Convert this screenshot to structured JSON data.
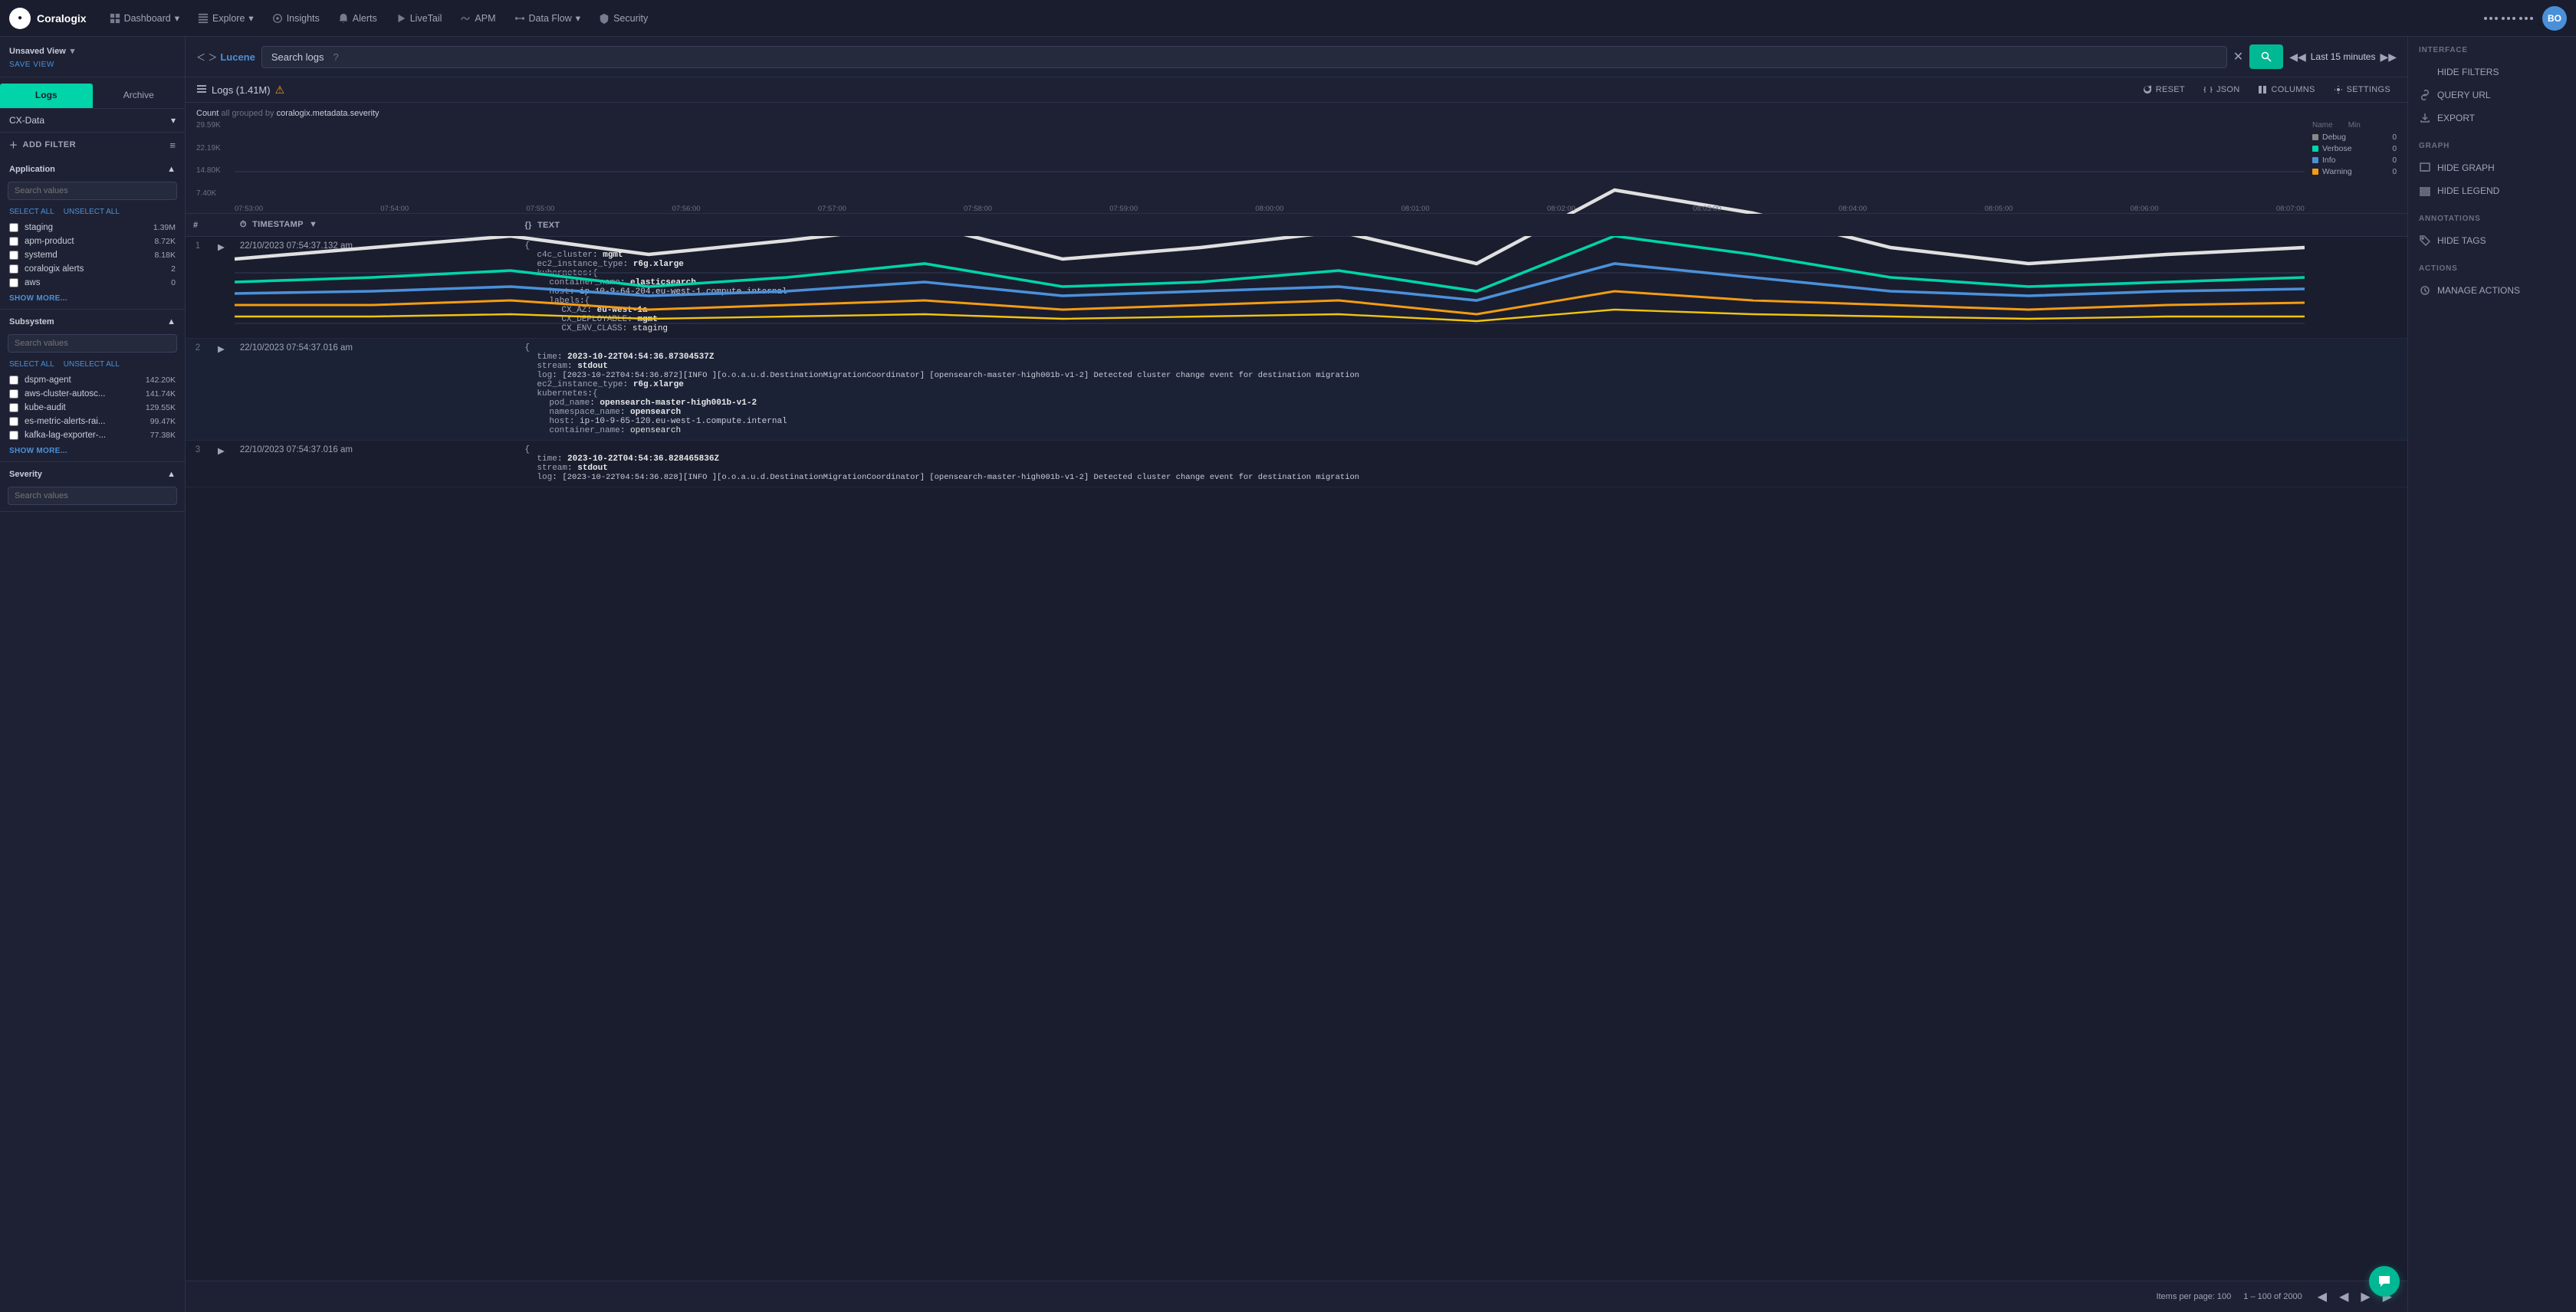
{
  "app": {
    "logo": "C",
    "logo_text": "Coralogix",
    "avatar": "BO"
  },
  "nav": {
    "items": [
      {
        "label": "Dashboard",
        "icon": "grid",
        "has_dropdown": true
      },
      {
        "label": "Explore",
        "icon": "explore",
        "has_dropdown": true
      },
      {
        "label": "Insights",
        "icon": "insights"
      },
      {
        "label": "Alerts",
        "icon": "bell"
      },
      {
        "label": "LiveTail",
        "icon": "play"
      },
      {
        "label": "APM",
        "icon": "apm"
      },
      {
        "label": "Data Flow",
        "icon": "dataflow",
        "has_dropdown": true
      },
      {
        "label": "Security",
        "icon": "shield"
      }
    ]
  },
  "sidebar": {
    "unsaved_view": "Unsaved View",
    "save_view": "SAVE VIEW",
    "tabs": [
      {
        "label": "Logs",
        "active": true
      },
      {
        "label": "Archive"
      }
    ],
    "cx_data": "CX-Data",
    "add_filter": "ADD FILTER",
    "sections": [
      {
        "title": "Application",
        "search_placeholder": "Search values",
        "items": [
          {
            "label": "staging",
            "count": "1.39M"
          },
          {
            "label": "apm-product",
            "count": "8.72K"
          },
          {
            "label": "systemd",
            "count": "8.18K"
          },
          {
            "label": "coralogix alerts",
            "count": "2"
          },
          {
            "label": "aws",
            "count": "0"
          }
        ],
        "show_more": "SHOW MORE..."
      },
      {
        "title": "Subsystem",
        "search_placeholder": "Search values",
        "items": [
          {
            "label": "dspm-agent",
            "count": "142.20K"
          },
          {
            "label": "aws-cluster-autosc...",
            "count": "141.74K"
          },
          {
            "label": "kube-audit",
            "count": "129.55K"
          },
          {
            "label": "es-metric-alerts-rai...",
            "count": "99.47K"
          },
          {
            "label": "kafka-lag-exporter-...",
            "count": "77.38K"
          }
        ],
        "show_more": "SHOW MORE..."
      },
      {
        "title": "Severity",
        "search_placeholder": "Search values"
      }
    ]
  },
  "search_bar": {
    "breadcrumb_arrow": "< >",
    "breadcrumb_name": "Lucene",
    "search_label": "Search logs",
    "help_icon": "?",
    "time_label": "Last 15 minutes"
  },
  "toolbar": {
    "logs_count": "Logs (1.41M)",
    "reset": "RESET",
    "json": "JSON",
    "columns": "COLUMNS",
    "settings": "SETTINGS"
  },
  "chart": {
    "title_count": "Count",
    "title_grouped": "all grouped by",
    "title_field": "coralogix.metadata.severity",
    "y_labels": [
      "29.59K",
      "22.19K",
      "14.80K",
      "7.40K"
    ],
    "x_labels": [
      "07:53:00",
      "07:54:00",
      "07:55:00",
      "07:56:00",
      "07:57:00",
      "07:58:00",
      "07:59:00",
      "08:00:00",
      "08:01:00",
      "08:02:00",
      "08:03:00",
      "08:04:00",
      "08:05:00",
      "08:06:00",
      "08:07:00"
    ],
    "legend": [
      {
        "label": "Debug",
        "color": "#888",
        "count": "0",
        "min_label": "Min"
      },
      {
        "label": "Verbose",
        "color": "#00d4a8",
        "count": "0"
      },
      {
        "label": "Info",
        "color": "#4a90d9",
        "count": "0"
      },
      {
        "label": "Warning",
        "color": "#f39c12",
        "count": "0"
      }
    ]
  },
  "table": {
    "columns": [
      "#",
      "",
      "TIMESTAMP",
      "TEXT"
    ],
    "rows": [
      {
        "num": "1",
        "timestamp": "22/10/2023 07:54:37.132 am",
        "text_lines": [
          "{",
          "  c4c_cluster: mgmt",
          "  ec2_instance_type: r6g.xlarge",
          "  kubernetes:{",
          "    container_name: elasticsearch",
          "    host: ip-10-9-64-204.eu-west-1.compute.internal",
          "    labels:{",
          "      CX_AZ: eu-west-1a",
          "      CX_DEPLOYABLE: mgmt",
          "      CX_ENV_CLASS: staging"
        ]
      },
      {
        "num": "2",
        "timestamp": "22/10/2023 07:54:37.016 am",
        "text_lines": [
          "{",
          "  time: 2023-10-22T04:54:36.87304537Z",
          "  stream: stdout",
          "  log: [2023-10-22T04:54:36.872][INFO ][o.o.a.u.d.DestinationMigrationCoordinator] [opensearch-master-high001b-v1-2] Detected cluster change event for destination migration",
          "  ec2_instance_type: r6g.xlarge",
          "  kubernetes:{",
          "    pod_name: opensearch-master-high001b-v1-2",
          "    namespace_name: opensearch",
          "    host: ip-10-9-65-120.eu-west-1.compute.internal",
          "    container_name: opensearch"
        ]
      },
      {
        "num": "3",
        "timestamp": "22/10/2023 07:54:37.016 am",
        "text_lines": [
          "{",
          "  time: 2023-10-22T04:54:36.828465836Z",
          "  stream: stdout",
          "  log: [2023-10-22T04:54:36.828][INFO ][o.o.a.u.d.DestinationMigrationCoordinator] [opensearch-master-high001b-v1-2] Detected cluster change event for destination migration"
        ]
      }
    ]
  },
  "footer": {
    "items_per_page": "Items per page: 100",
    "range": "1 – 100 of 2000"
  },
  "right_panel": {
    "interface_title": "INTERFACE",
    "hide_filters": "HIDE FILTERS",
    "query_url": "QUERY URL",
    "export": "EXPORT",
    "graph_title": "GRAPH",
    "hide_graph": "HIDE GRAPH",
    "hide_legend": "HIDE LEGEND",
    "annotations_title": "ANNOTATIONS",
    "hide_tags": "HIDE TAGS",
    "actions_title": "ACTIONS",
    "manage_actions": "MANAGE ACTIONS"
  }
}
